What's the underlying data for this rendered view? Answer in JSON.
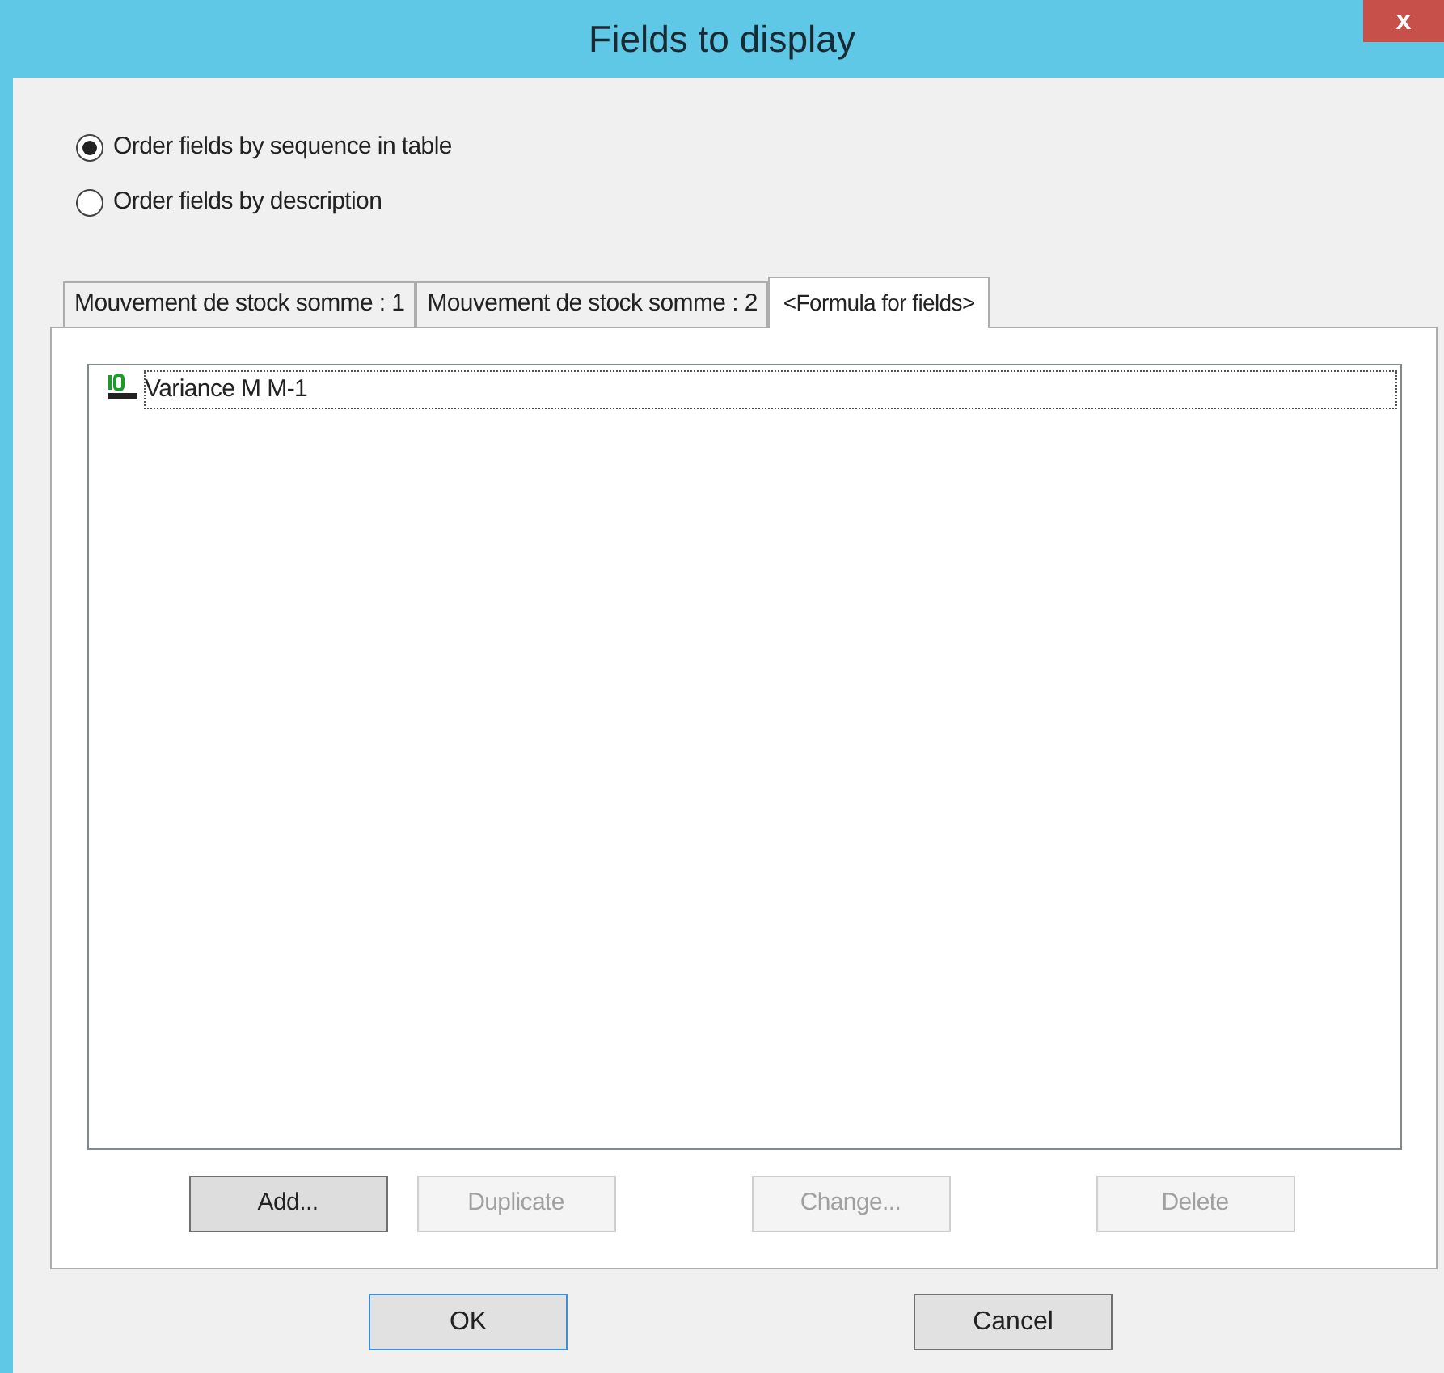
{
  "window": {
    "title": "Fields to display",
    "close": "x"
  },
  "order_options": [
    {
      "label": "Order fields by sequence in table",
      "selected": true
    },
    {
      "label": "Order fields by description",
      "selected": false
    }
  ],
  "tabs": [
    {
      "label": "Mouvement de stock somme : 1",
      "selected": false
    },
    {
      "label": "Mouvement de stock somme : 2",
      "selected": false
    },
    {
      "label": "<Formula for fields>",
      "selected": true
    }
  ],
  "list": {
    "items": [
      {
        "label": "Variance M M-1",
        "selected": true
      }
    ]
  },
  "list_buttons": [
    {
      "label": "Add...",
      "disabled": false
    },
    {
      "label": "Duplicate",
      "disabled": true
    },
    {
      "label": "Change...",
      "disabled": true
    },
    {
      "label": "Delete",
      "disabled": true
    }
  ],
  "buttons": [
    {
      "label": "OK",
      "default": true
    },
    {
      "label": "Cancel",
      "default": false
    }
  ]
}
